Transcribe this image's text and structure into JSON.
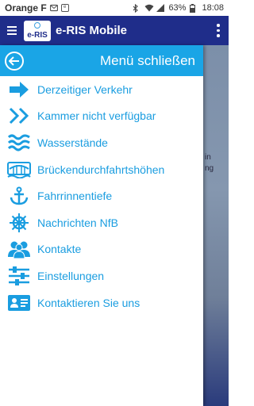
{
  "status_bar": {
    "carrier": "Orange F",
    "battery_percent": "63%",
    "time": "18:08"
  },
  "app_bar": {
    "logo_text": "e-RIS",
    "title": "e-RIS Mobile"
  },
  "drawer": {
    "title": "Menü schließen",
    "items": [
      {
        "label": "Derzeitiger Verkehr",
        "icon": "arrow-right-icon"
      },
      {
        "label": "Kammer nicht verfügbar",
        "icon": "double-chevron-icon"
      },
      {
        "label": "Wasserstände",
        "icon": "waves-icon"
      },
      {
        "label": "Brückendurchfahrtshöhen",
        "icon": "bridge-icon"
      },
      {
        "label": "Fahrrinnentiefe",
        "icon": "anchor-icon"
      },
      {
        "label": "Nachrichten NfB",
        "icon": "ship-wheel-icon"
      },
      {
        "label": "Kontakte",
        "icon": "contacts-icon"
      },
      {
        "label": "Einstellungen",
        "icon": "sliders-icon"
      },
      {
        "label": "Kontaktieren Sie uns",
        "icon": "contact-card-icon"
      }
    ]
  },
  "background": {
    "fragment_1": "in",
    "fragment_2": "ng"
  },
  "colors": {
    "app_bar": "#1f2d8a",
    "drawer_header": "#1aa5e6",
    "menu_text": "#1a9de0"
  }
}
